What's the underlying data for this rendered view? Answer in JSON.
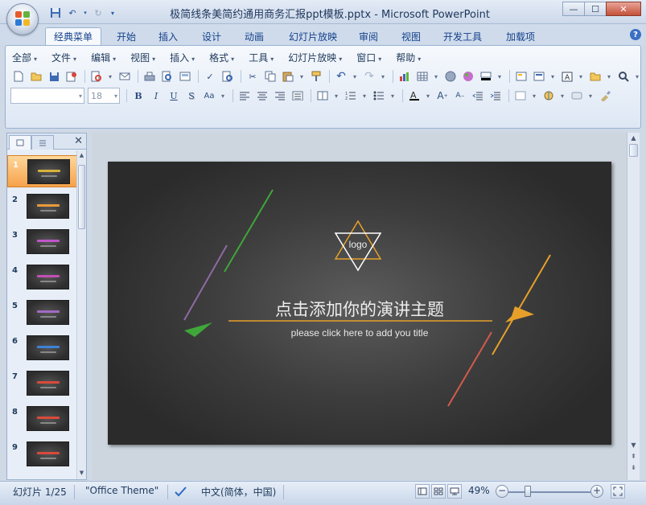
{
  "window": {
    "title": "极简线条美简约通用商务汇报ppt模板.pptx - Microsoft PowerPoint",
    "minimize": "—",
    "maximize": "☐",
    "close": "✕"
  },
  "quick_access": [
    "save-icon",
    "undo-icon",
    "redo-icon",
    "customize-icon"
  ],
  "tabs": [
    {
      "label": "经典菜单",
      "active": true
    },
    {
      "label": "开始",
      "active": false
    },
    {
      "label": "插入",
      "active": false
    },
    {
      "label": "设计",
      "active": false
    },
    {
      "label": "动画",
      "active": false
    },
    {
      "label": "幻灯片放映",
      "active": false
    },
    {
      "label": "审阅",
      "active": false
    },
    {
      "label": "视图",
      "active": false
    },
    {
      "label": "开发工具",
      "active": false
    },
    {
      "label": "加载项",
      "active": false
    }
  ],
  "help_label": "?",
  "menu": [
    {
      "label": "全部"
    },
    {
      "label": "文件"
    },
    {
      "label": "编辑"
    },
    {
      "label": "视图"
    },
    {
      "label": "插入"
    },
    {
      "label": "格式"
    },
    {
      "label": "工具"
    },
    {
      "label": "幻灯片放映"
    },
    {
      "label": "窗口"
    },
    {
      "label": "帮助"
    }
  ],
  "format": {
    "font_name": "",
    "font_size": "18"
  },
  "slides_panel": {
    "close": "✕",
    "thumbnails": [
      {
        "number": "1",
        "active": true,
        "accent": "#d8b23a"
      },
      {
        "number": "2",
        "active": false,
        "accent": "#e89a3a"
      },
      {
        "number": "3",
        "active": false,
        "accent": "#c055c8"
      },
      {
        "number": "4",
        "active": false,
        "accent": "#c24fb3"
      },
      {
        "number": "5",
        "active": false,
        "accent": "#a26bc2"
      },
      {
        "number": "6",
        "active": false,
        "accent": "#3d82d6"
      },
      {
        "number": "7",
        "active": false,
        "accent": "#d94a3a"
      },
      {
        "number": "8",
        "active": false,
        "accent": "#d94a3a"
      },
      {
        "number": "9",
        "active": false,
        "accent": "#d94a3a"
      }
    ]
  },
  "slide": {
    "logo": "logo",
    "title": "点击添加你的演讲主题",
    "subtitle": "please click here to add you title",
    "colors": {
      "gold": "#e6a02a",
      "green": "#3fa63a",
      "purple": "#8e6aa6",
      "red": "#d35b4b",
      "background": "#3d3d3d"
    }
  },
  "status": {
    "slide_info": "幻灯片 1/25",
    "theme": "\"Office Theme\"",
    "language": "中文(简体，中国)",
    "zoom": "49%",
    "zoom_minus": "−",
    "zoom_plus": "+"
  }
}
